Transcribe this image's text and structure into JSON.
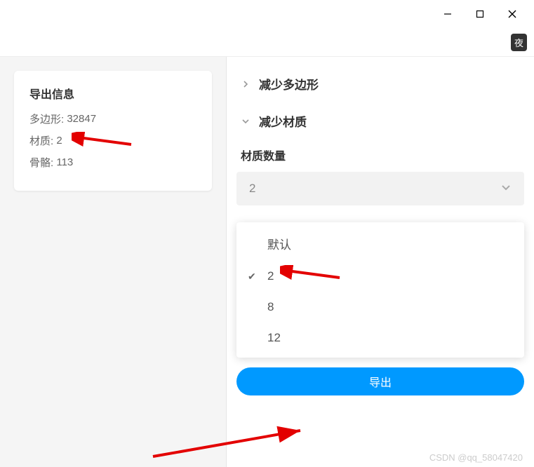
{
  "titlebar": {
    "night_badge": "夜"
  },
  "info_card": {
    "title": "导出信息",
    "polygons_label": "多边形:",
    "polygons_value": "32847",
    "materials_label": "材质:",
    "materials_value": "2",
    "bones_label": "骨骼:",
    "bones_value": "113"
  },
  "right": {
    "section_reduce_poly": "减少多边形",
    "section_reduce_mat": "减少材质",
    "material_count_label": "材质数量",
    "selected_value": "2",
    "dropdown": {
      "opt_default": "默认",
      "opt_2": "2",
      "opt_8": "8",
      "opt_12": "12"
    },
    "export_button": "导出"
  },
  "watermark": "CSDN @qq_58047420"
}
